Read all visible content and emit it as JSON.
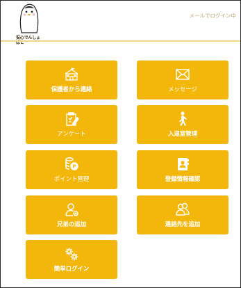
{
  "header": {
    "logo_text": "安心でんしょばと",
    "login_status": "メールでログイン中"
  },
  "menu": [
    {
      "label": "保護者から連絡",
      "icon": "school-building-icon"
    },
    {
      "label": "メッセージ",
      "icon": "envelope-icon"
    },
    {
      "label": "アンケート",
      "icon": "clipboard-edit-icon"
    },
    {
      "label": "入退室管理",
      "icon": "walking-person-icon"
    },
    {
      "label": "ポイント管理",
      "icon": "coins-icon"
    },
    {
      "label": "登録情報確認",
      "icon": "contact-card-icon"
    },
    {
      "label": "兄弟の追加",
      "icon": "person-add-icon"
    },
    {
      "label": "連絡先を追加",
      "icon": "two-persons-icon"
    },
    {
      "label": "簡単ログイン",
      "icon": "gears-icon"
    }
  ],
  "colors": {
    "tile_bg": "#f3b70c",
    "tile_text": "#ffffff",
    "header_bar": "#f6d48a",
    "status_text": "#bfa670"
  }
}
